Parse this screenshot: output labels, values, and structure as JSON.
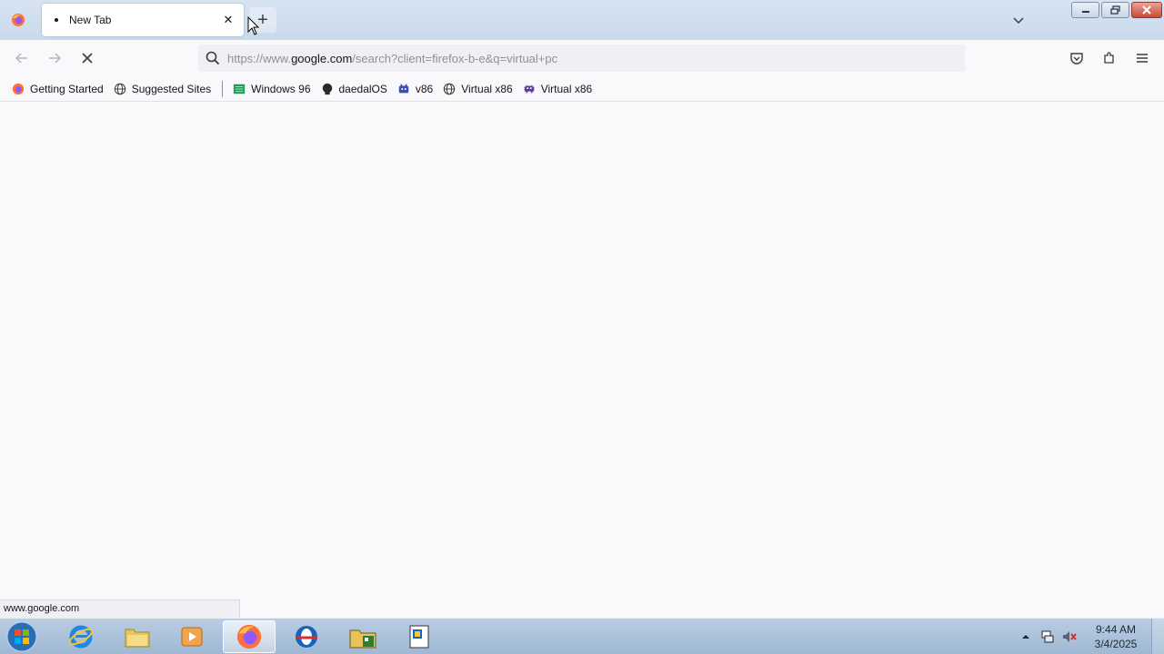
{
  "window": {
    "tabs": [
      {
        "title": "New Tab"
      }
    ],
    "new_tab_symbol": "+",
    "close_symbol": "✕"
  },
  "navbar": {
    "url_prefix": "https://www.",
    "url_host": "google.com",
    "url_rest": "/search?client=firefox-b-e&q=virtual+pc"
  },
  "bookmarks": [
    {
      "label": "Getting Started",
      "icon": "firefox-icon"
    },
    {
      "label": "Suggested Sites",
      "icon": "globe-icon"
    },
    {
      "label": "Windows 96",
      "icon": "windows96-icon"
    },
    {
      "label": "daedalOS",
      "icon": "daedalos-icon"
    },
    {
      "label": "v86",
      "icon": "v86-icon"
    },
    {
      "label": "Virtual x86",
      "icon": "globe-icon"
    },
    {
      "label": "Virtual x86",
      "icon": "invader-icon"
    }
  ],
  "status": {
    "text": "www.google.com"
  },
  "taskbar": {
    "clock_time": "9:44 AM",
    "clock_date": "3/4/2025"
  }
}
